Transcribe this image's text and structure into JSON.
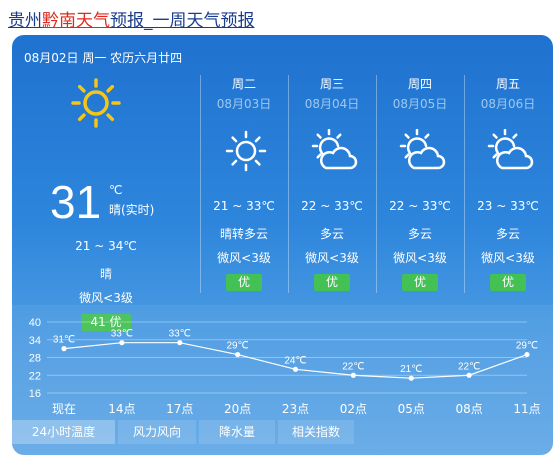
{
  "page_title": {
    "prefix": "贵州",
    "highlight": "黔南天气",
    "suffix": "预报_一周天气预报"
  },
  "today": {
    "date_line": "08月02日 周一 农历六月廿四",
    "temp": "31",
    "unit": "℃",
    "now_label": "晴(实时)",
    "range": "21 ~ 34℃",
    "condition": "晴",
    "wind": "微风<3级",
    "aqi": "41 优",
    "icon": "sun-icon"
  },
  "days": [
    {
      "name": "周二",
      "date": "08月03日",
      "range": "21 ~ 33℃",
      "condition": "晴转多云",
      "wind": "微风<3级",
      "aqi": "优",
      "icon": "sun-outline-icon"
    },
    {
      "name": "周三",
      "date": "08月04日",
      "range": "22 ~ 33℃",
      "condition": "多云",
      "wind": "微风<3级",
      "aqi": "优",
      "icon": "partly-cloudy-icon"
    },
    {
      "name": "周四",
      "date": "08月05日",
      "range": "22 ~ 33℃",
      "condition": "多云",
      "wind": "微风<3级",
      "aqi": "优",
      "icon": "partly-cloudy-icon"
    },
    {
      "name": "周五",
      "date": "08月06日",
      "range": "23 ~ 33℃",
      "condition": "多云",
      "wind": "微风<3级",
      "aqi": "优",
      "icon": "partly-cloudy-icon"
    }
  ],
  "tabs": [
    "24小时温度",
    "风力风向",
    "降水量",
    "相关指数"
  ],
  "colors": {
    "card_top": "#1f72cf",
    "card_bottom": "#62a8e6",
    "aqi_badge": "#43c154",
    "sun_yellow": "#f5c518",
    "title_link": "#1a3c8c",
    "title_highlight": "#e0281c"
  },
  "chart_data": {
    "type": "line",
    "categories": [
      "现在",
      "14点",
      "17点",
      "20点",
      "23点",
      "02点",
      "05点",
      "08点",
      "11点"
    ],
    "series": [
      {
        "values": [
          31,
          33,
          33,
          29,
          24,
          22,
          21,
          22,
          29
        ]
      }
    ],
    "value_labels": [
      "31℃",
      "33℃",
      "33℃",
      "29℃",
      "24℃",
      "22℃",
      "21℃",
      "22℃",
      "29℃"
    ],
    "y_ticks": [
      16,
      22,
      28,
      34,
      40
    ],
    "ylim": [
      16,
      40
    ],
    "grid": true,
    "title": "",
    "xlabel": "",
    "ylabel": ""
  }
}
